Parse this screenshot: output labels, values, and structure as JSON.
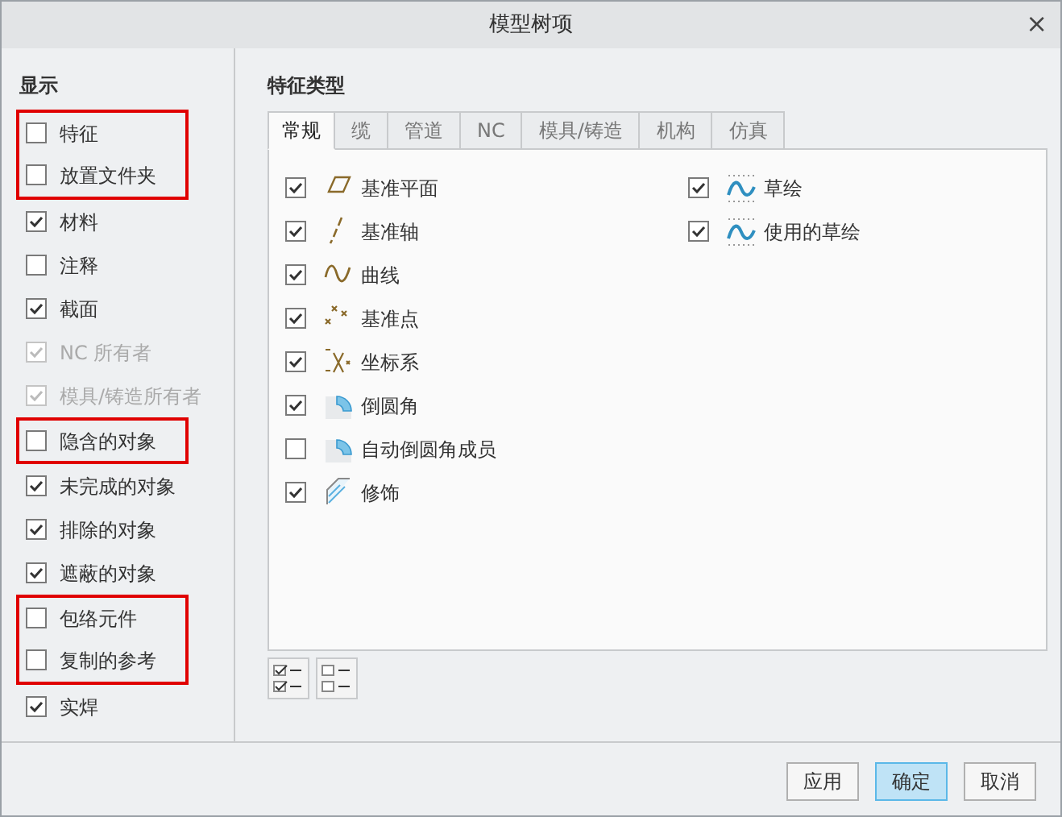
{
  "window": {
    "title": "模型树项",
    "close": "×"
  },
  "display": {
    "heading": "显示",
    "items": [
      {
        "label": "特征",
        "checked": false,
        "disabled": false,
        "highlighted": true
      },
      {
        "label": "放置文件夹",
        "checked": false,
        "disabled": false,
        "highlighted": true
      },
      {
        "label": "材料",
        "checked": true,
        "disabled": false,
        "highlighted": false
      },
      {
        "label": "注释",
        "checked": false,
        "disabled": false,
        "highlighted": false
      },
      {
        "label": "截面",
        "checked": true,
        "disabled": false,
        "highlighted": false
      },
      {
        "label": "NC 所有者",
        "checked": true,
        "disabled": true,
        "highlighted": false
      },
      {
        "label": "模具/铸造所有者",
        "checked": true,
        "disabled": true,
        "highlighted": false
      },
      {
        "label": "隐含的对象",
        "checked": false,
        "disabled": false,
        "highlighted": true
      },
      {
        "label": "未完成的对象",
        "checked": true,
        "disabled": false,
        "highlighted": false
      },
      {
        "label": "排除的对象",
        "checked": true,
        "disabled": false,
        "highlighted": false
      },
      {
        "label": "遮蔽的对象",
        "checked": true,
        "disabled": false,
        "highlighted": false
      },
      {
        "label": "包络元件",
        "checked": false,
        "disabled": false,
        "highlighted": true
      },
      {
        "label": "复制的参考",
        "checked": false,
        "disabled": false,
        "highlighted": true
      },
      {
        "label": "实焊",
        "checked": true,
        "disabled": false,
        "highlighted": false
      }
    ]
  },
  "feature_types": {
    "heading": "特征类型",
    "tabs": [
      {
        "label": "常规",
        "selected": true
      },
      {
        "label": "缆",
        "selected": false
      },
      {
        "label": "管道",
        "selected": false
      },
      {
        "label": "NC",
        "selected": false
      },
      {
        "label": "模具/铸造",
        "selected": false
      },
      {
        "label": "机构",
        "selected": false
      },
      {
        "label": "仿真",
        "selected": false
      }
    ],
    "column_1": [
      {
        "label": "基准平面",
        "checked": true
      },
      {
        "label": "基准轴",
        "checked": true
      },
      {
        "label": "曲线",
        "checked": true
      },
      {
        "label": "基准点",
        "checked": true
      },
      {
        "label": "坐标系",
        "checked": true
      },
      {
        "label": "倒圆角",
        "checked": true
      },
      {
        "label": "自动倒圆角成员",
        "checked": false
      },
      {
        "label": "修饰",
        "checked": true
      }
    ],
    "column_2": [
      {
        "label": "草绘",
        "checked": true
      },
      {
        "label": "使用的草绘",
        "checked": true
      }
    ]
  },
  "buttons": [
    {
      "label": "应用",
      "primary": false
    },
    {
      "label": "确定",
      "primary": true
    },
    {
      "label": "取消",
      "primary": false
    }
  ]
}
